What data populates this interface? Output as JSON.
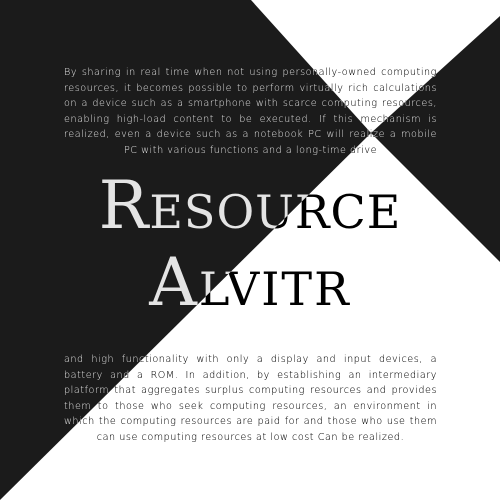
{
  "title": {
    "line1": "Resource",
    "line2": "Alvitr"
  },
  "paragraphs": {
    "top": "By sharing in real time when not using personally-owned computing resources, it becomes possible to perform virtually rich calculations on a device such as a smartphone with scarce computing resources, enabling high-load content to be executed. If this mechanism is realized, even a device such as a notebook PC will realize a mobile PC with various functions and a long-time drive",
    "bottom": "and high functionality with only a display and input devices, a battery and a ROM. In addition, by establishing an intermediary platform that aggregates surplus computing resources and provides them to those who seek computing resources, an environment in which the computing resources are paid for and those who use them can use computing resources at low cost Can be realized."
  },
  "colors": {
    "dark": "#1b1b1b",
    "light": "#ffffff"
  }
}
